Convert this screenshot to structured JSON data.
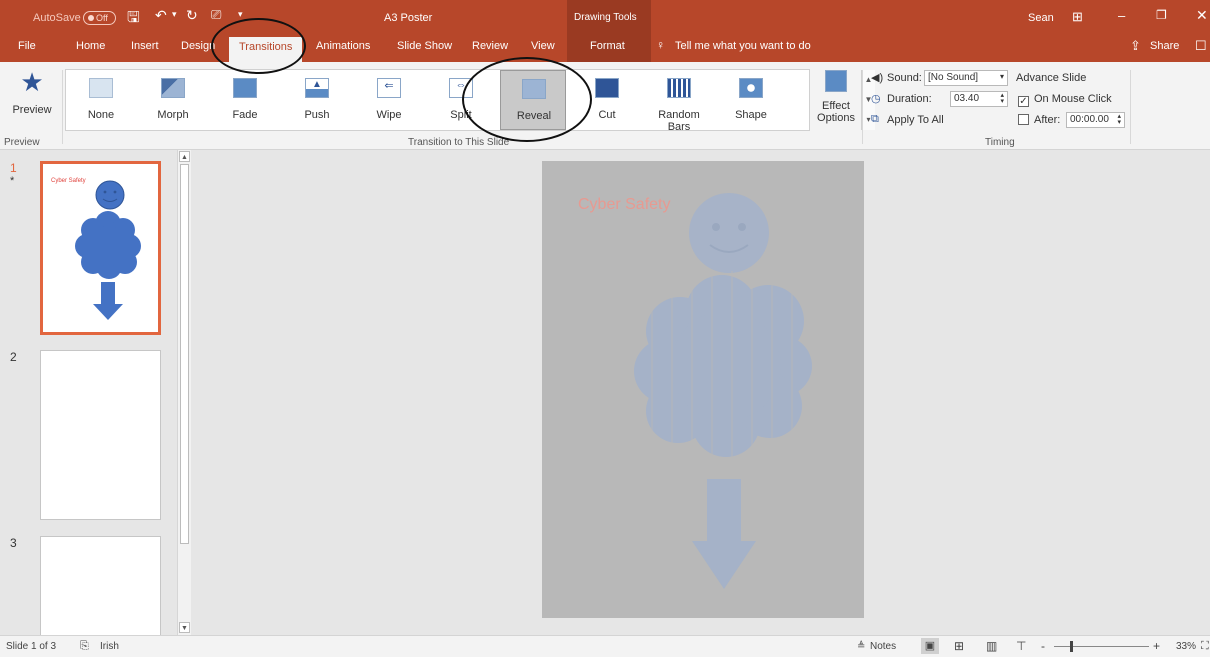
{
  "titlebar": {
    "autosave_label": "AutoSave",
    "autosave_state": "Off",
    "document_title": "A3 Poster",
    "context_group": "Drawing Tools",
    "user": "Sean",
    "share": "Share"
  },
  "tabs": [
    "File",
    "Home",
    "Insert",
    "Design",
    "Transitions",
    "Animations",
    "Slide Show",
    "Review",
    "View",
    "Format"
  ],
  "active_tab": "Transitions",
  "tell_me": "Tell me what you want to do",
  "ribbon": {
    "preview_label": "Preview",
    "preview_group": "Preview",
    "transitions": [
      "None",
      "Morph",
      "Fade",
      "Push",
      "Wipe",
      "Split",
      "Reveal",
      "Cut",
      "Random Bars",
      "Shape"
    ],
    "selected_transition": "Reveal",
    "transition_group": "Transition to This Slide",
    "effect_options": [
      "Effect",
      "Options"
    ],
    "sound_label": "Sound:",
    "sound_value": "[No Sound]",
    "duration_label": "Duration:",
    "duration_value": "03.40",
    "apply_all": "Apply To All",
    "advance_slide": "Advance Slide",
    "on_mouse_click": "On Mouse Click",
    "on_mouse_click_checked": true,
    "after_label": "After:",
    "after_value": "00:00.00",
    "after_checked": false,
    "timing_group": "Timing"
  },
  "thumbnails": [
    {
      "number": "1",
      "marker": "*",
      "title": "Cyber Safety"
    },
    {
      "number": "2"
    },
    {
      "number": "3"
    }
  ],
  "slide": {
    "title": "Cyber Safety"
  },
  "statusbar": {
    "slide_info": "Slide 1 of 3",
    "language": "Irish",
    "notes": "Notes",
    "zoom_minus": "-",
    "zoom_plus": "+",
    "zoom": "33%"
  },
  "colors": {
    "accent": "#b7472a",
    "selection": "#e2663f",
    "shape": "#4472c4"
  }
}
